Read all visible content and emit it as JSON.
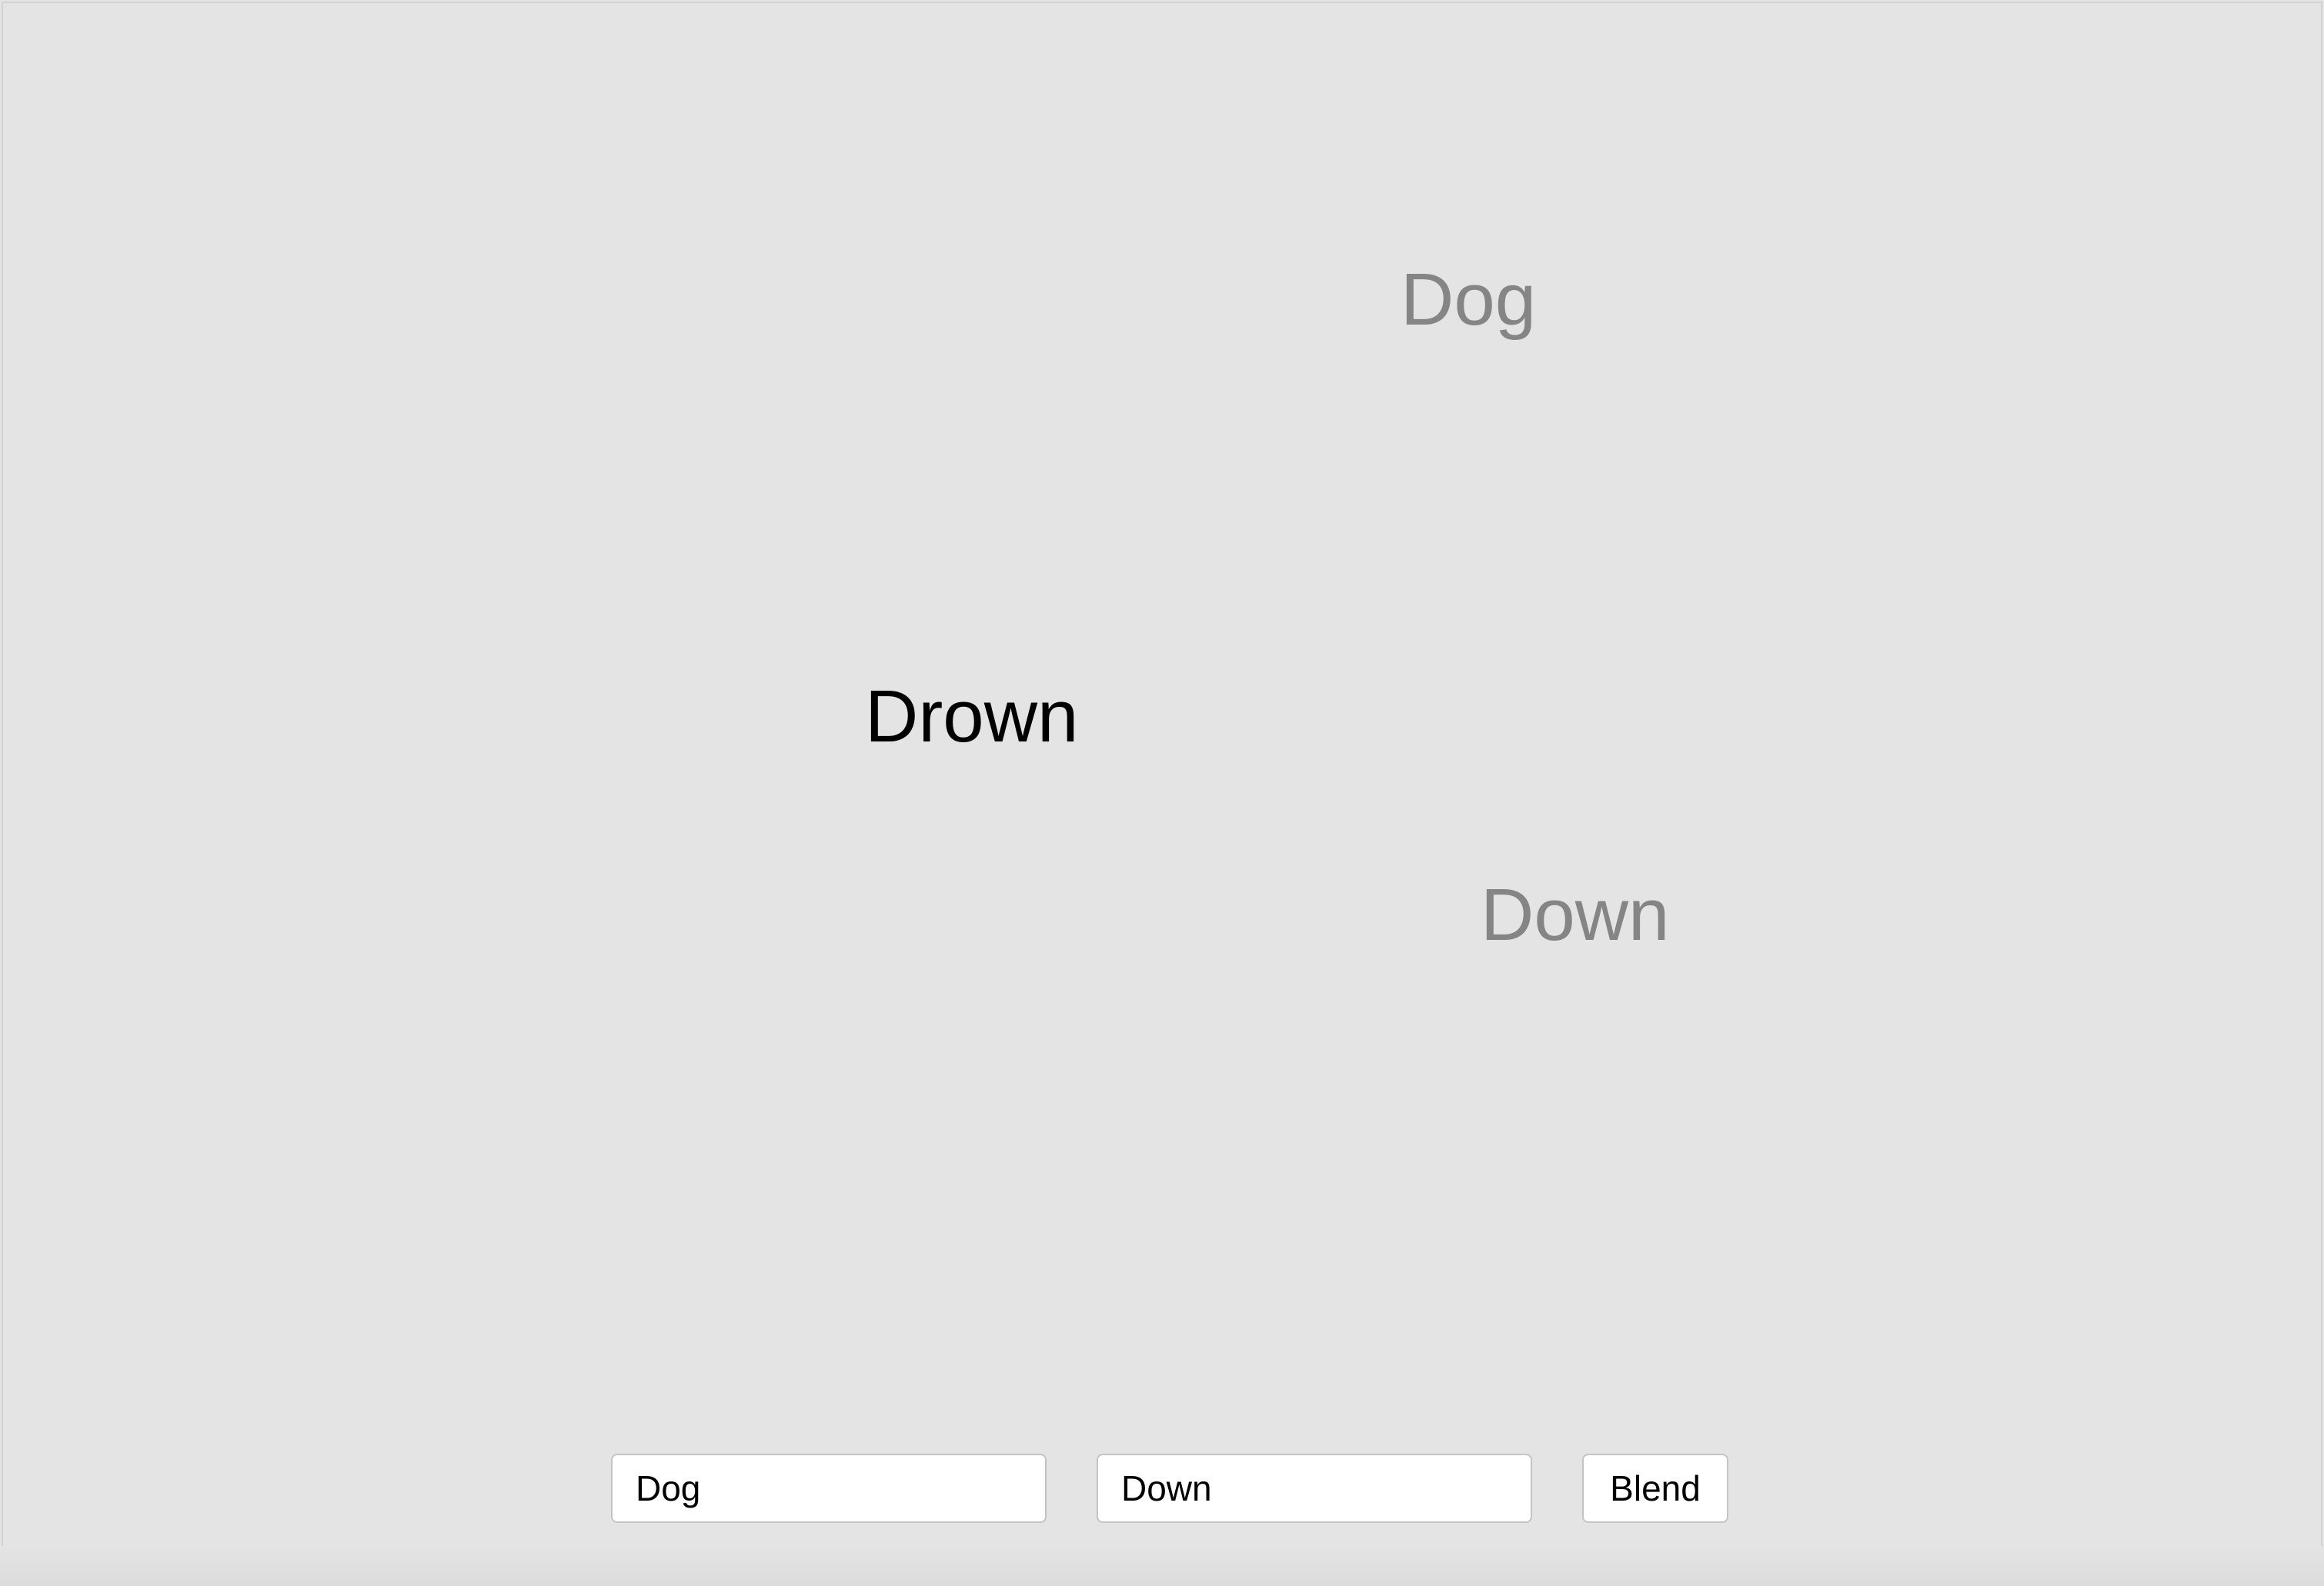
{
  "canvas": {
    "background_color": "#e4e4e4"
  },
  "words": {
    "input_a": {
      "text": "Dog",
      "color": "#858585"
    },
    "input_b": {
      "text": "Down",
      "color": "#858585"
    },
    "blend": {
      "text": "Drown",
      "color": "#000000"
    }
  },
  "controls": {
    "field_a_value": "Dog",
    "field_b_value": "Down",
    "blend_button_label": "Blend"
  }
}
